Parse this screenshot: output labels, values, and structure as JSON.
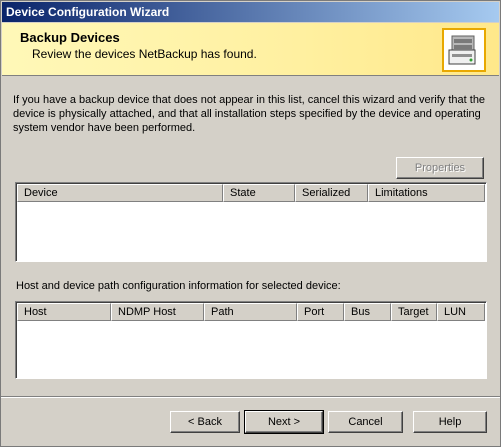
{
  "window": {
    "title": "Device Configuration Wizard"
  },
  "header": {
    "title": "Backup Devices",
    "subtitle": "Review the devices NetBackup has found.",
    "icon": "server-devices-icon"
  },
  "description": "If you have a backup device that does not appear in this list, cancel this wizard and verify that the device is physically attached, and that all installation steps specified by the device and operating system vendor have been performed.",
  "properties_button": {
    "label": "Properties",
    "enabled": false
  },
  "devices_table": {
    "columns": [
      "Device",
      "State",
      "Serialized",
      "Limitations"
    ],
    "rows": []
  },
  "path_section": {
    "label": "Host and device path configuration information for selected device:",
    "columns": [
      "Host",
      "NDMP Host",
      "Path",
      "Port",
      "Bus",
      "Target",
      "LUN"
    ],
    "rows": []
  },
  "footer": {
    "back": "< Back",
    "next": "Next >",
    "cancel": "Cancel",
    "help": "Help"
  }
}
